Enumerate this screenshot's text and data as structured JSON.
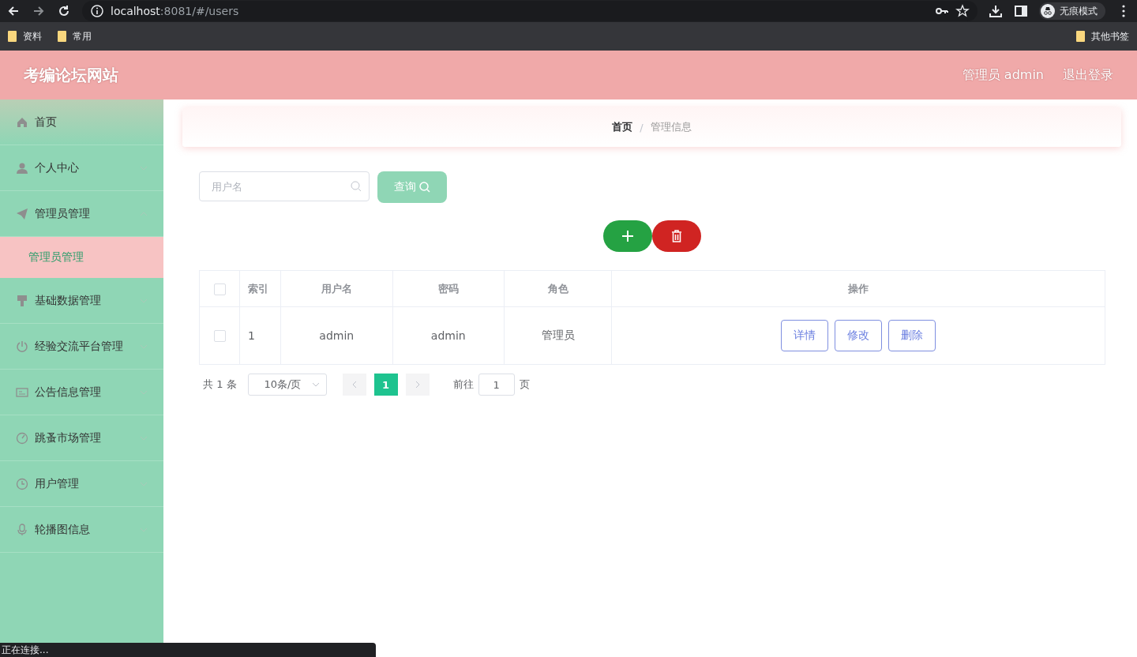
{
  "browser": {
    "url_host": "localhost",
    "url_rest": ":8081/#/users",
    "profile": "无痕模式",
    "bookmarks": [
      "资料",
      "常用"
    ],
    "other_bookmarks": "其他书签",
    "status": "正在连接..."
  },
  "header": {
    "title": "考编论坛网站",
    "user": "管理员 admin",
    "logout": "退出登录"
  },
  "sidebar": {
    "items": [
      {
        "label": "首页",
        "kind": "link"
      },
      {
        "label": "个人中心",
        "kind": "group",
        "expanded": false
      },
      {
        "label": "管理员管理",
        "kind": "group",
        "expanded": true,
        "children": [
          {
            "label": "管理员管理",
            "selected": true
          }
        ]
      },
      {
        "label": "基础数据管理",
        "kind": "group",
        "expanded": false
      },
      {
        "label": "经验交流平台管理",
        "kind": "group",
        "expanded": false
      },
      {
        "label": "公告信息管理",
        "kind": "group",
        "expanded": false
      },
      {
        "label": "跳蚤市场管理",
        "kind": "group",
        "expanded": false
      },
      {
        "label": "用户管理",
        "kind": "group",
        "expanded": false
      },
      {
        "label": "轮播图信息",
        "kind": "group",
        "expanded": false
      }
    ]
  },
  "breadcrumb": {
    "items": [
      "首页",
      "管理信息"
    ],
    "separator": "/"
  },
  "search": {
    "placeholder": "用户名",
    "button": "查询"
  },
  "table": {
    "header_checked": false,
    "columns": [
      "索引",
      "用户名",
      "密码",
      "角色",
      "操作"
    ],
    "rows": [
      {
        "checked": false,
        "cells": [
          "1",
          "admin",
          "admin",
          "管理员"
        ],
        "actions": [
          "详情",
          "修改",
          "删除"
        ]
      }
    ]
  },
  "pagination": {
    "total": "共 1 条",
    "page_size": "10条/页",
    "pages": [
      {
        "label": "1",
        "selected": true
      }
    ],
    "goto": "前往",
    "goto_value": "1",
    "goto_suffix": "页"
  }
}
